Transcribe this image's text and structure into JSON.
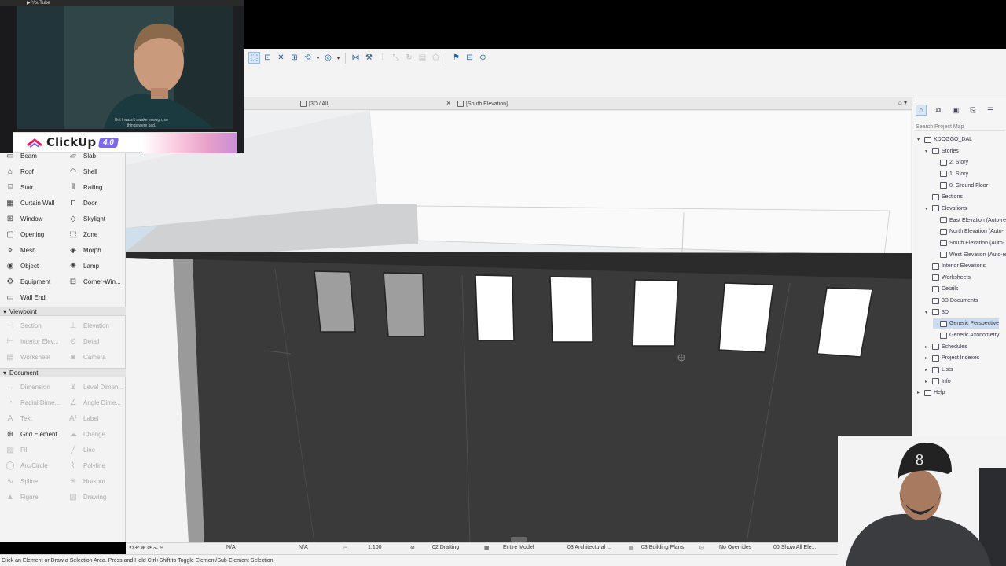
{
  "toolbar": {
    "buttons": [
      "select",
      "view",
      "xray",
      "grid",
      "orbit",
      "render",
      "trace",
      "magic",
      "ruler",
      "align",
      "cut",
      "stack",
      "flag",
      "snap",
      "cam"
    ]
  },
  "tabs": {
    "tab1": "[3D / All]",
    "tab2": "[South Elevation]",
    "close": "×"
  },
  "toolbox": {
    "design_tools": [
      {
        "label": "Beam",
        "icon": "beam-icon",
        "dim": false
      },
      {
        "label": "Slab",
        "icon": "slab-icon",
        "dim": false
      },
      {
        "label": "Roof",
        "icon": "roof-icon",
        "dim": false
      },
      {
        "label": "Shell",
        "icon": "shell-icon",
        "dim": false
      },
      {
        "label": "Stair",
        "icon": "stair-icon",
        "dim": false
      },
      {
        "label": "Railing",
        "icon": "railing-icon",
        "dim": false
      },
      {
        "label": "Curtain Wall",
        "icon": "curtain-wall-icon",
        "dim": false
      },
      {
        "label": "Door",
        "icon": "door-icon",
        "dim": false
      },
      {
        "label": "Window",
        "icon": "window-icon",
        "dim": false
      },
      {
        "label": "Skylight",
        "icon": "skylight-icon",
        "dim": false
      },
      {
        "label": "Opening",
        "icon": "opening-icon",
        "dim": false
      },
      {
        "label": "Zone",
        "icon": "zone-icon",
        "dim": false
      },
      {
        "label": "Mesh",
        "icon": "mesh-icon",
        "dim": false
      },
      {
        "label": "Morph",
        "icon": "morph-icon",
        "dim": false
      },
      {
        "label": "Object",
        "icon": "object-icon",
        "dim": false
      },
      {
        "label": "Lamp",
        "icon": "lamp-icon",
        "dim": false
      },
      {
        "label": "Equipment",
        "icon": "equipment-icon",
        "dim": false
      },
      {
        "label": "Corner-Win...",
        "icon": "corner-window-icon",
        "dim": false
      }
    ],
    "wall_end": "Wall End",
    "viewpoint_header": "Viewpoint",
    "viewpoint_tools": [
      {
        "label": "Section",
        "icon": "section-icon",
        "dim": true
      },
      {
        "label": "Elevation",
        "icon": "elevation-icon",
        "dim": true
      },
      {
        "label": "Interior Elev...",
        "icon": "interior-elevation-icon",
        "dim": true
      },
      {
        "label": "Detail",
        "icon": "detail-icon",
        "dim": true
      },
      {
        "label": "Worksheet",
        "icon": "worksheet-icon",
        "dim": true
      },
      {
        "label": "Camera",
        "icon": "camera-icon",
        "dim": true
      }
    ],
    "document_header": "Document",
    "document_tools": [
      {
        "label": "Dimension",
        "icon": "dimension-icon",
        "dim": true
      },
      {
        "label": "Level Dimen...",
        "icon": "level-dimension-icon",
        "dim": true
      },
      {
        "label": "Radial Dime...",
        "icon": "radial-dimension-icon",
        "dim": true
      },
      {
        "label": "Angle Dime...",
        "icon": "angle-dimension-icon",
        "dim": true
      },
      {
        "label": "Text",
        "icon": "text-icon",
        "dim": true
      },
      {
        "label": "Label",
        "icon": "label-icon",
        "dim": true
      },
      {
        "label": "Grid Element",
        "icon": "grid-element-icon",
        "dim": false
      },
      {
        "label": "Change",
        "icon": "change-icon",
        "dim": true
      },
      {
        "label": "Fill",
        "icon": "fill-icon",
        "dim": true
      },
      {
        "label": "Line",
        "icon": "line-icon",
        "dim": true
      },
      {
        "label": "Arc/Circle",
        "icon": "arc-icon",
        "dim": true
      },
      {
        "label": "Polyline",
        "icon": "polyline-icon",
        "dim": true
      },
      {
        "label": "Spline",
        "icon": "spline-icon",
        "dim": true
      },
      {
        "label": "Hotspot",
        "icon": "hotspot-icon",
        "dim": true
      },
      {
        "label": "Figure",
        "icon": "figure-icon",
        "dim": true
      },
      {
        "label": "Drawing",
        "icon": "drawing-icon",
        "dim": true
      }
    ]
  },
  "viewbar": {
    "na1": "N/A",
    "na2": "N/A",
    "scale": "1:100",
    "layer": "02 Drafting",
    "model": "Entire Model",
    "pen": "03 Architectural ...",
    "plan": "03 Building Plans",
    "overrides": "No Overrides",
    "show": "00 Show All Ele..."
  },
  "status": "Click an Element or Draw a Selection Area. Press and Hold Ctrl+Shift to Toggle Element/Sub-Element Selection.",
  "navigator": {
    "search_placeholder": "Search Project Map",
    "items": [
      {
        "label": "KDOGGO_DAL",
        "indent": 0,
        "tw": "▾",
        "sel": false
      },
      {
        "label": "Stories",
        "indent": 1,
        "tw": "▾",
        "sel": false
      },
      {
        "label": "2. Story",
        "indent": 2,
        "tw": "",
        "sel": false
      },
      {
        "label": "1. Story",
        "indent": 2,
        "tw": "",
        "sel": false
      },
      {
        "label": "0. Ground Floor",
        "indent": 2,
        "tw": "",
        "sel": false
      },
      {
        "label": "Sections",
        "indent": 1,
        "tw": "",
        "sel": false
      },
      {
        "label": "Elevations",
        "indent": 1,
        "tw": "▾",
        "sel": false
      },
      {
        "label": "East Elevation (Auto-re",
        "indent": 2,
        "tw": "",
        "sel": false
      },
      {
        "label": "North Elevation (Auto-",
        "indent": 2,
        "tw": "",
        "sel": false
      },
      {
        "label": "South Elevation (Auto-",
        "indent": 2,
        "tw": "",
        "sel": false
      },
      {
        "label": "West Elevation (Auto-re",
        "indent": 2,
        "tw": "",
        "sel": false
      },
      {
        "label": "Interior Elevations",
        "indent": 1,
        "tw": "",
        "sel": false
      },
      {
        "label": "Worksheets",
        "indent": 1,
        "tw": "",
        "sel": false
      },
      {
        "label": "Details",
        "indent": 1,
        "tw": "",
        "sel": false
      },
      {
        "label": "3D Documents",
        "indent": 1,
        "tw": "",
        "sel": false
      },
      {
        "label": "3D",
        "indent": 1,
        "tw": "▾",
        "sel": false
      },
      {
        "label": "Generic Perspective",
        "indent": 2,
        "tw": "",
        "sel": true
      },
      {
        "label": "Generic Axonometry",
        "indent": 2,
        "tw": "",
        "sel": false
      },
      {
        "label": "Schedules",
        "indent": 1,
        "tw": "▸",
        "sel": false
      },
      {
        "label": "Project Indexes",
        "indent": 1,
        "tw": "▸",
        "sel": false
      },
      {
        "label": "Lists",
        "indent": 1,
        "tw": "▸",
        "sel": false
      },
      {
        "label": "Info",
        "indent": 1,
        "tw": "▸",
        "sel": false
      },
      {
        "label": "Help",
        "indent": 0,
        "tw": "▸",
        "sel": false
      }
    ]
  },
  "webcam": {
    "subtitle": "But I wasn't awake enough, so things were bad.",
    "brand": "ClickUp",
    "version": "4.0"
  }
}
